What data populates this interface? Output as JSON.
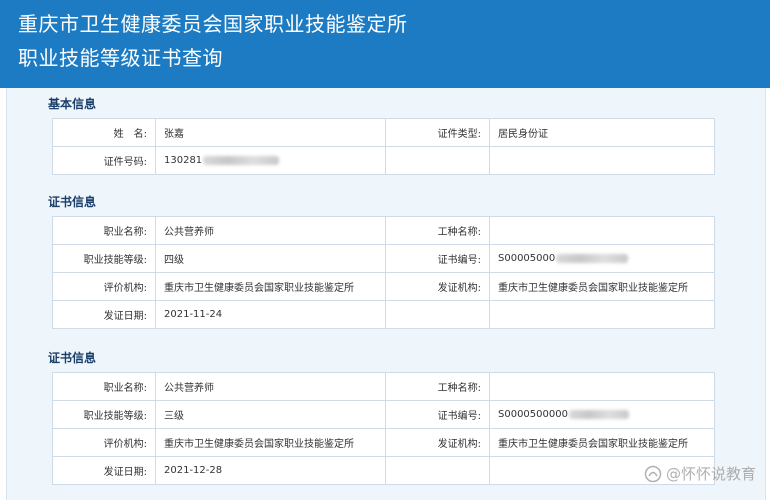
{
  "header": {
    "line1": "重庆市卫生健康委员会国家职业技能鉴定所",
    "line2": "职业技能等级证书查询"
  },
  "basic": {
    "title": "基本信息",
    "name_label": "姓　名:",
    "name_value": "张嘉",
    "id_type_label": "证件类型:",
    "id_type_value": "居民身份证",
    "id_no_label": "证件号码:",
    "id_no_value": "130281"
  },
  "cert1": {
    "title": "证书信息",
    "occupation_label": "职业名称:",
    "occupation_value": "公共营养师",
    "work_type_label": "工种名称:",
    "work_type_value": "",
    "level_label": "职业技能等级:",
    "level_value": "四级",
    "cert_no_label": "证书编号:",
    "cert_no_value": "S00005000",
    "eval_org_label": "评价机构:",
    "eval_org_value": "重庆市卫生健康委员会国家职业技能鉴定所",
    "issue_org_label": "发证机构:",
    "issue_org_value": "重庆市卫生健康委员会国家职业技能鉴定所",
    "issue_date_label": "发证日期:",
    "issue_date_value": "2021-11-24"
  },
  "cert2": {
    "title": "证书信息",
    "occupation_label": "职业名称:",
    "occupation_value": "公共营养师",
    "work_type_label": "工种名称:",
    "work_type_value": "",
    "level_label": "职业技能等级:",
    "level_value": "三级",
    "cert_no_label": "证书编号:",
    "cert_no_value": "S0000500000",
    "eval_org_label": "评价机构:",
    "eval_org_value": "重庆市卫生健康委员会国家职业技能鉴定所",
    "issue_org_label": "发证机构:",
    "issue_org_value": "重庆市卫生健康委员会国家职业技能鉴定所",
    "issue_date_label": "发证日期:",
    "issue_date_value": "2021-12-28"
  },
  "watermark": {
    "text": "@怀怀说教育"
  }
}
